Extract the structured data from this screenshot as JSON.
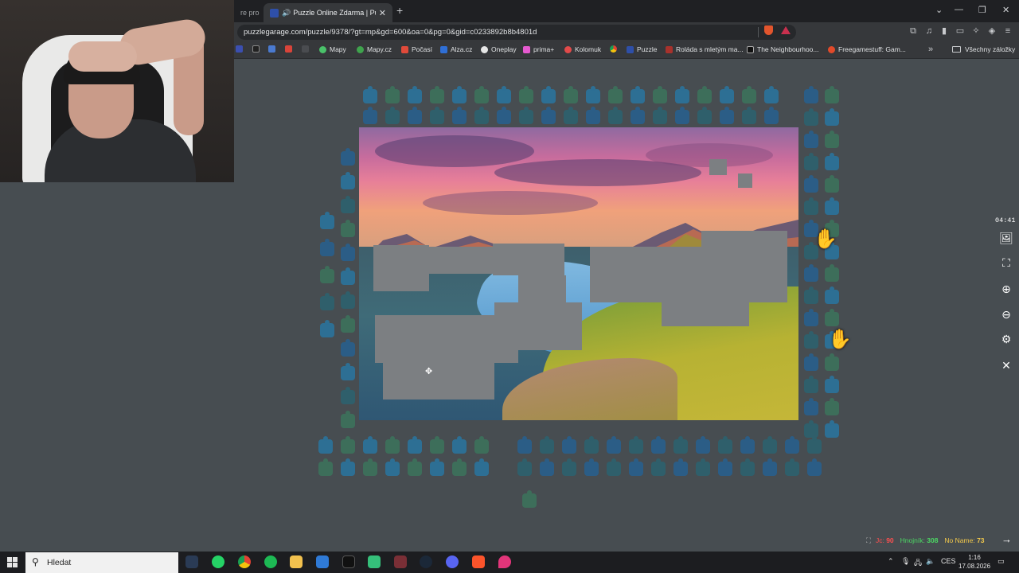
{
  "browser": {
    "prev_tab_label": "re pro",
    "active_tab_title": "Puzzle Online Zdarma | Puzzle",
    "url": "puzzlegarage.com/puzzle/9378/?gt=mp&gd=600&oa=0&pg=0&gid=c0233892b8b4801d",
    "bookmarks": [
      "Mapy",
      "Mapy.cz",
      "Počasí",
      "Alza.cz",
      "Oneplay",
      "prima+",
      "Kolomuk",
      "Puzzle",
      "Roláda s mletým ma...",
      "The Neighbourhoo...",
      "Freegamestuff: Gam..."
    ],
    "all_bookmarks_label": "Všechny záložky",
    "icons": {
      "new_tab": "+",
      "tab_close": "✕",
      "speaker": "🔊",
      "minimize": "—",
      "restore": "❐",
      "close": "✕",
      "chevron_down": "⌄",
      "more_bookmarks": "»"
    }
  },
  "game": {
    "timer": "04:41",
    "side_buttons": {
      "image": "🖼",
      "fullscreen": "⛶",
      "zoom_in": "⊕",
      "zoom_out": "⊖",
      "settings": "⚙",
      "close": "✕"
    },
    "players": [
      {
        "name": "Jc:",
        "score": "90",
        "color": "#ff4f4f"
      },
      {
        "name": "Hnojník:",
        "score": "308",
        "color": "#4cd964"
      },
      {
        "name": "No Name:",
        "score": "73",
        "color": "#f2c94c"
      }
    ],
    "next_arrow": "→"
  },
  "taskbar": {
    "search_placeholder": "Hledat",
    "language": "CES",
    "time": "1:16",
    "date": "17.08.2026"
  }
}
